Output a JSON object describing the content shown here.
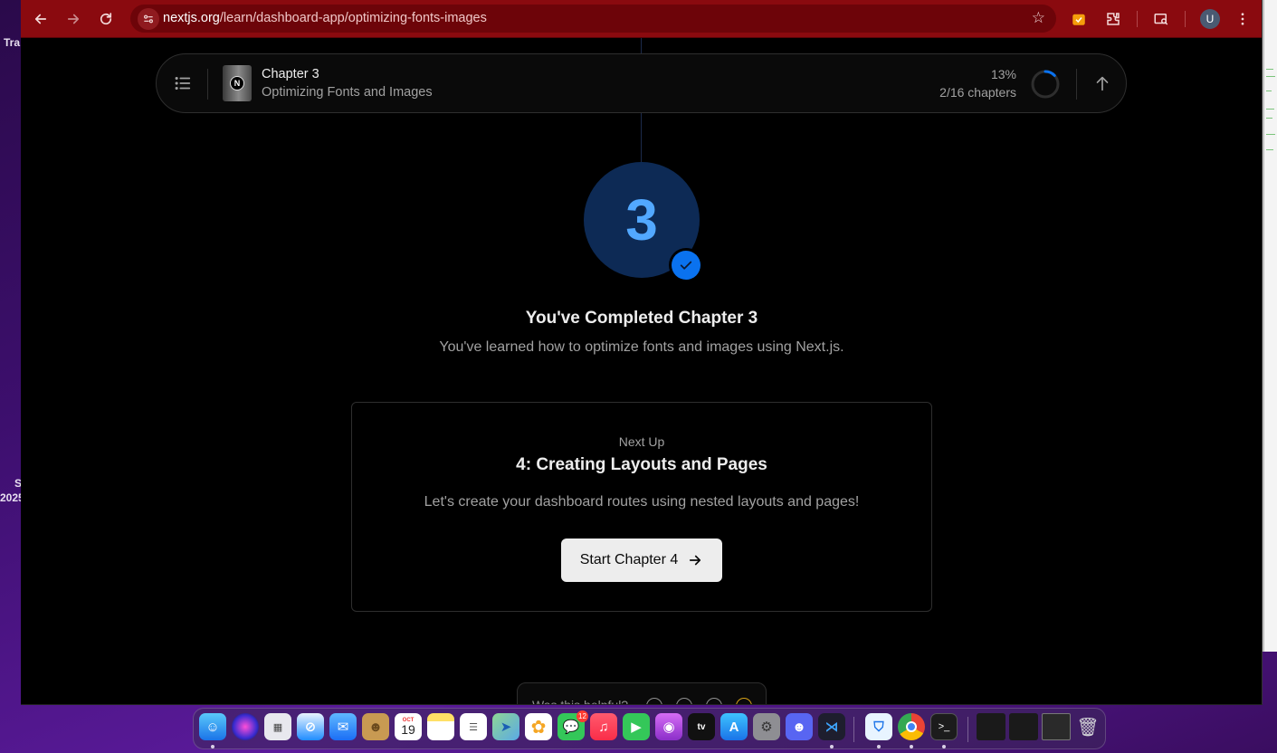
{
  "desktop": {
    "left_labels": [
      "Tra",
      "S",
      "2025"
    ]
  },
  "browser": {
    "url_host": "nextjs.org",
    "url_path": "/learn/dashboard-app/optimizing-fonts-images",
    "profile_initial": "U"
  },
  "chapter_bar": {
    "title": "Chapter 3",
    "subtitle": "Optimizing Fonts and Images",
    "percent": "13%",
    "count": "2/16 chapters",
    "progress_fraction": 0.13,
    "accent": "#0a72ef"
  },
  "completion": {
    "chapter_number": "3",
    "title": "You've Completed Chapter 3",
    "message": "You've learned how to optimize fonts and images using Next.js."
  },
  "next_up": {
    "label": "Next Up",
    "title": "4: Creating Layouts and Pages",
    "description": "Let's create your dashboard routes using nested layouts and pages!",
    "button_label": "Start Chapter 4"
  },
  "feedback": {
    "prompt": "Was this helpful?"
  },
  "dock": {
    "calendar_month": "OCT",
    "calendar_day": "19",
    "messages_badge": "12",
    "apps": [
      "Finder",
      "Siri",
      "Launchpad",
      "Safari",
      "Mail",
      "Contacts",
      "Calendar",
      "Notes",
      "Reminders",
      "Maps",
      "Photos",
      "Messages",
      "Music",
      "FaceTime",
      "Podcasts",
      "TV",
      "App Store",
      "System Settings",
      "Discord",
      "Visual Studio Code",
      "Proton VPN",
      "Chrome",
      "Terminal"
    ]
  }
}
